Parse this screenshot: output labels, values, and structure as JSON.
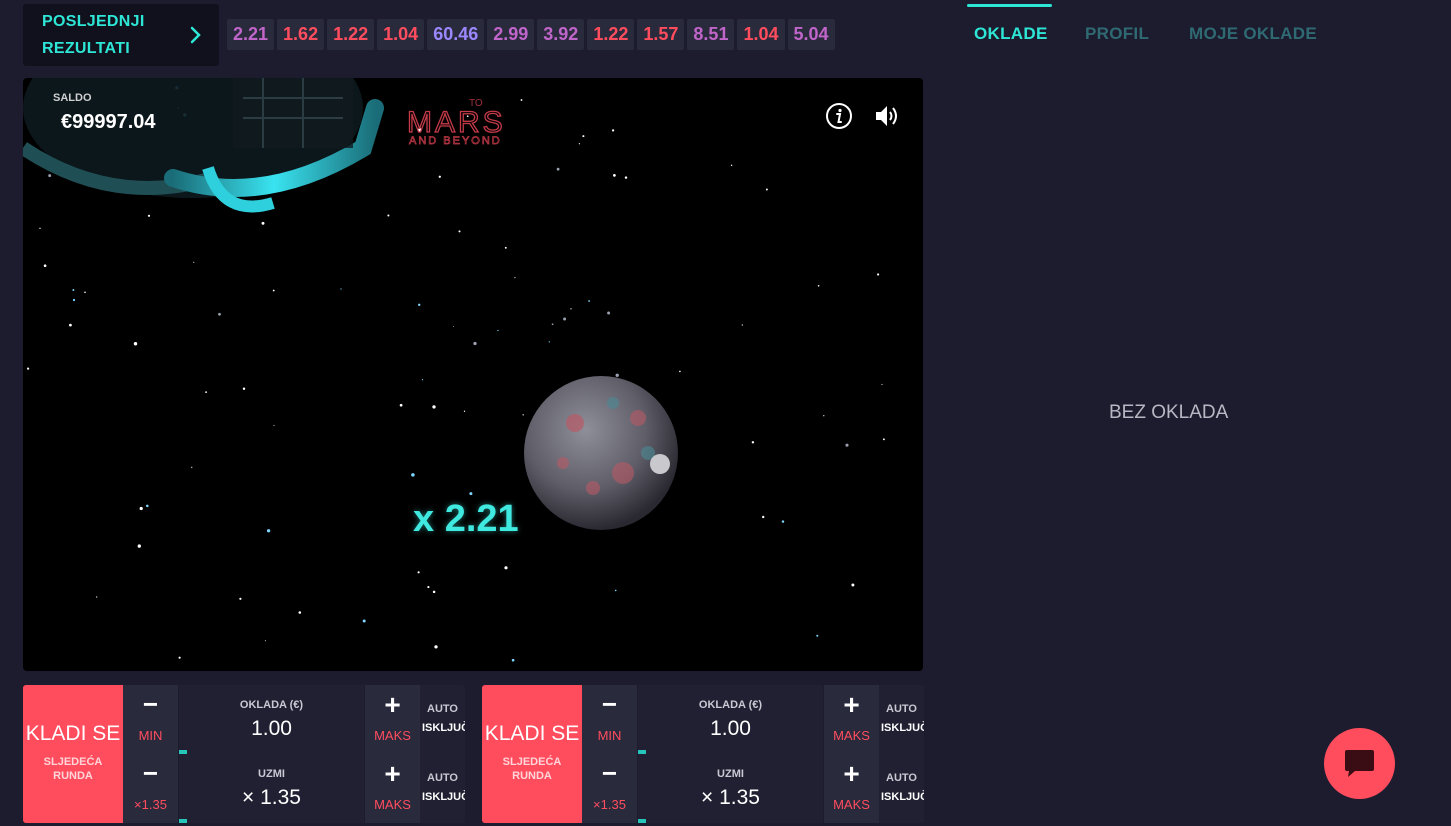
{
  "results": {
    "button_label": "POSLJEDNJI\nREZULTATI",
    "multipliers": [
      {
        "value": "2.21",
        "color": "purple"
      },
      {
        "value": "1.62",
        "color": "red"
      },
      {
        "value": "1.22",
        "color": "red"
      },
      {
        "value": "1.04",
        "color": "red"
      },
      {
        "value": "60.46",
        "color": "blue"
      },
      {
        "value": "2.99",
        "color": "purple"
      },
      {
        "value": "3.92",
        "color": "purple"
      },
      {
        "value": "1.22",
        "color": "red"
      },
      {
        "value": "1.57",
        "color": "red"
      },
      {
        "value": "8.51",
        "color": "purple"
      },
      {
        "value": "1.04",
        "color": "red"
      },
      {
        "value": "5.04",
        "color": "purple"
      }
    ]
  },
  "game": {
    "balance_label": "SALDO",
    "balance_value": "€99997.04",
    "logo_top": "TO",
    "logo_main": "MARS",
    "logo_sub": "AND BEYOND",
    "current_multiplier": "x 2.21"
  },
  "bet_panels": [
    {
      "bet_button": "KLADI SE",
      "bet_button_sub": "SLJEDEĆA\nRUNDA",
      "row1": {
        "minus": "−",
        "minus_sub": "MIN",
        "label": "OKLADA (€)",
        "value": "1.00",
        "plus": "+",
        "plus_sub": "MAKS",
        "auto_label": "AUTO",
        "auto_value": "ISKLJUČENO"
      },
      "row2": {
        "minus": "−",
        "minus_sub": "×1.35",
        "label": "UZMI",
        "value": "× 1.35",
        "plus": "+",
        "plus_sub": "MAKS",
        "auto_label": "AUTO",
        "auto_value": "ISKLJUČENO"
      }
    },
    {
      "bet_button": "KLADI SE",
      "bet_button_sub": "SLJEDEĆA\nRUNDA",
      "row1": {
        "minus": "−",
        "minus_sub": "MIN",
        "label": "OKLADA (€)",
        "value": "1.00",
        "plus": "+",
        "plus_sub": "MAKS",
        "auto_label": "AUTO",
        "auto_value": "ISKLJUČENO"
      },
      "row2": {
        "minus": "−",
        "minus_sub": "×1.35",
        "label": "UZMI",
        "value": "× 1.35",
        "plus": "+",
        "plus_sub": "MAKS",
        "auto_label": "AUTO",
        "auto_value": "ISKLJUČENO"
      }
    }
  ],
  "sidebar": {
    "tabs": [
      {
        "label": "OKLADE",
        "active": true
      },
      {
        "label": "PROFIL",
        "active": false
      },
      {
        "label": "MOJE OKLADE",
        "active": false
      }
    ],
    "empty_message": "BEZ OKLADA"
  },
  "colors": {
    "accent": "#2ee6d6",
    "bet_red": "#ff4d5e",
    "background": "#1c1c2e"
  },
  "icons": [
    "chevron-right-icon",
    "info-icon",
    "sound-icon",
    "chat-icon"
  ]
}
